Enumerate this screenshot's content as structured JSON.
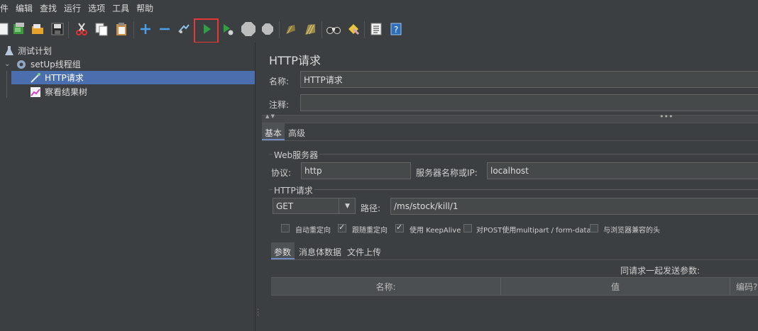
{
  "menu": [
    "件",
    "编辑",
    "查找",
    "运行",
    "选项",
    "工具",
    "帮助"
  ],
  "tree": {
    "items": [
      {
        "label": "测试计划",
        "icon": "flask-icon"
      },
      {
        "label": "setUp线程组",
        "icon": "gear-icon"
      },
      {
        "label": "HTTP请求",
        "icon": "pipette-icon"
      },
      {
        "label": "察看结果树",
        "icon": "graph-icon"
      }
    ]
  },
  "panel": {
    "title": "HTTP请求",
    "name_label": "名称:",
    "name_value": "HTTP请求",
    "comment_label": "注释:",
    "comment_value": "",
    "tabs": [
      "基本",
      "高级"
    ],
    "web_server_group": "Web服务器",
    "protocol_label": "协议:",
    "protocol_value": "http",
    "server_label": "服务器名称或IP:",
    "server_value": "localhost",
    "http_group": "HTTP请求",
    "method_value": "GET",
    "path_label": "路径:",
    "path_value": "/ms/stock/kill/1",
    "checkboxes": [
      {
        "label": "自动重定向",
        "checked": false
      },
      {
        "label": "跟随重定向",
        "checked": true
      },
      {
        "label": "使用 KeepAlive",
        "checked": true
      },
      {
        "label": "对POST使用multipart / form-data",
        "checked": false
      },
      {
        "label": "与浏览器兼容的头",
        "checked": false
      }
    ],
    "sub_tabs": [
      "参数",
      "消息体数据",
      "文件上传"
    ],
    "send_params_label": "同请求一起发送参数:",
    "table_headers": [
      "名称:",
      "值",
      "编码?"
    ]
  },
  "colors": {
    "selection": "#4b6eaf",
    "run_highlight": "#e53935",
    "run_green": "#2ea043"
  }
}
